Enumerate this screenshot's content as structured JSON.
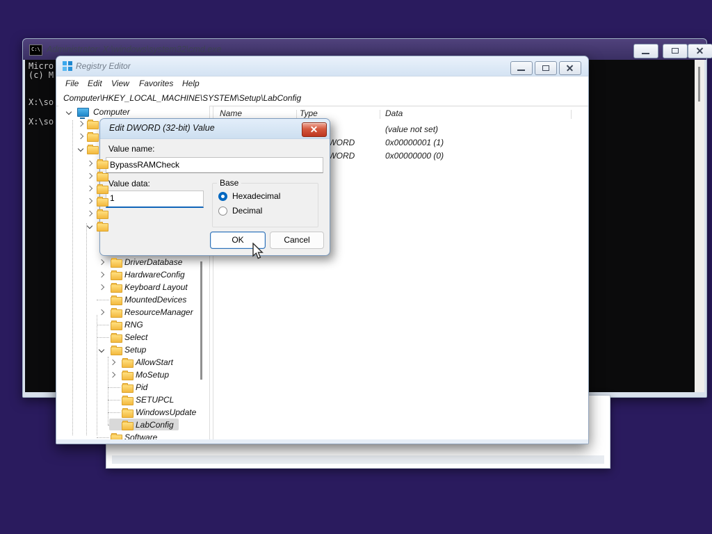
{
  "desktop": {
    "background_color": "#2a1b5e"
  },
  "cmd": {
    "title": "Administrator: X:\\windows\\system32\\cmd.exe",
    "icon_text": "C:\\",
    "console_lines": [
      "Micro",
      "(c) M",
      "X:\\so",
      "X:\\so"
    ]
  },
  "regedit": {
    "title": "Registry Editor",
    "menu_items": [
      "File",
      "Edit",
      "View",
      "Favorites",
      "Help"
    ],
    "address": "Computer\\HKEY_LOCAL_MACHINE\\SYSTEM\\Setup\\LabConfig",
    "columns": [
      "Name",
      "Type",
      "Data"
    ],
    "values": [
      {
        "name": "",
        "type": "",
        "data": "(value not set)"
      },
      {
        "name": "",
        "type": "REG_DWORD",
        "data": "0x00000001 (1)"
      },
      {
        "name": "",
        "type": "REG_DWORD",
        "data": "0x00000000 (0)"
      }
    ],
    "tree": {
      "root_label": "Computer",
      "items": [
        {
          "label": "",
          "level": 1,
          "arrow": "collapsed"
        },
        {
          "label": "",
          "level": 1,
          "arrow": "collapsed"
        },
        {
          "label": "",
          "level": 1,
          "arrow": "expanded"
        },
        {
          "label": "",
          "level": 2,
          "arrow": "collapsed"
        },
        {
          "label": "",
          "level": 2,
          "arrow": "collapsed"
        },
        {
          "label": "",
          "level": 2,
          "arrow": "collapsed"
        },
        {
          "label": "",
          "level": 2,
          "arrow": "collapsed"
        },
        {
          "label": "",
          "level": 2,
          "arrow": "collapsed"
        },
        {
          "label": "",
          "level": 2,
          "arrow": "expanded"
        },
        {
          "label": "DriverDatabase",
          "level": 3,
          "arrow": "collapsed"
        },
        {
          "label": "HardwareConfig",
          "level": 3,
          "arrow": "collapsed"
        },
        {
          "label": "Keyboard Layout",
          "level": 3,
          "arrow": "collapsed"
        },
        {
          "label": "MountedDevices",
          "level": 3,
          "arrow": "none"
        },
        {
          "label": "ResourceManager",
          "level": 3,
          "arrow": "collapsed"
        },
        {
          "label": "RNG",
          "level": 3,
          "arrow": "none"
        },
        {
          "label": "Select",
          "level": 3,
          "arrow": "none"
        },
        {
          "label": "Setup",
          "level": 3,
          "arrow": "expanded"
        },
        {
          "label": "AllowStart",
          "level": 4,
          "arrow": "collapsed"
        },
        {
          "label": "MoSetup",
          "level": 4,
          "arrow": "collapsed"
        },
        {
          "label": "Pid",
          "level": 4,
          "arrow": "none"
        },
        {
          "label": "SETUPCL",
          "level": 4,
          "arrow": "none"
        },
        {
          "label": "WindowsUpdate",
          "level": 4,
          "arrow": "none"
        },
        {
          "label": "LabConfig",
          "level": 4,
          "arrow": "none",
          "selected": true
        },
        {
          "label": "Software",
          "level": 3,
          "arrow": "none",
          "partial": true
        }
      ]
    }
  },
  "dialog": {
    "title": "Edit DWORD (32-bit) Value",
    "value_name_label": "Value name:",
    "value_name": "BypassRAMCheck",
    "value_data_label": "Value data:",
    "value_data": "1",
    "base_label": "Base",
    "options": [
      {
        "label": "Hexadecimal",
        "selected": true
      },
      {
        "label": "Decimal",
        "selected": false
      }
    ],
    "ok_label": "OK",
    "cancel_label": "Cancel"
  }
}
